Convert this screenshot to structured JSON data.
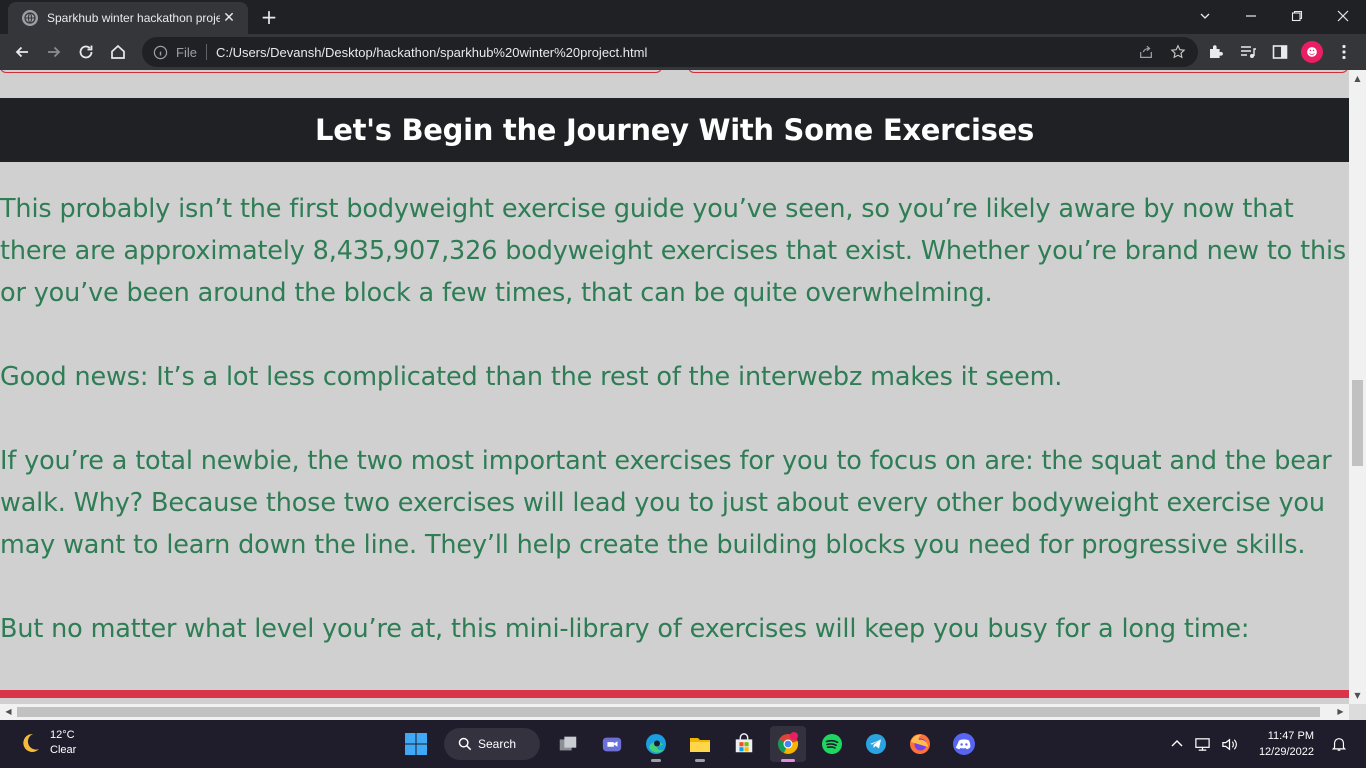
{
  "browser": {
    "tab_title": "Sparkhub winter hackathon proje",
    "new_tab_symbol": "+",
    "omnibox_chip": "File",
    "url": "C:/Users/Devansh/Desktop/hackathon/sparkhub%20winter%20project.html"
  },
  "page": {
    "heading": "Let's Begin the Journey With Some Exercises",
    "paragraphs": [
      "This probably isn’t the first bodyweight exercise guide you’ve seen, so you’re likely aware by now that there are approximately 8,435,907,326 bodyweight exercises that exist. Whether you’re brand new to this or you’ve been around the block a few times, that can be quite overwhelming.",
      "Good news: It’s a lot less complicated than the rest of the interwebz makes it seem.",
      "If you’re a total newbie, the two most important exercises for you to focus on are: the squat and the bear walk. Why? Because those two exercises will lead you to just about every other bodyweight exercise you may want to learn down the line. They’ll help create the building blocks you need for progressive skills.",
      "But no matter what level you’re at, this mini-library of exercises will keep you busy for a long time:"
    ],
    "colors": {
      "page_background": "#d0d0d0",
      "banner_background": "#1f2125",
      "body_text": "#2e7d55",
      "accent_red": "#d9344a"
    }
  },
  "taskbar": {
    "weather_temp": "12°C",
    "weather_condition": "Clear",
    "search_label": "Search",
    "time": "11:47 PM",
    "date": "12/29/2022",
    "apps": [
      "task-view-icon",
      "meet-icon",
      "edge-icon",
      "file-explorer-icon",
      "store-icon",
      "chrome-icon",
      "spotify-icon",
      "telegram-icon",
      "firefox-icon",
      "discord-icon"
    ]
  }
}
